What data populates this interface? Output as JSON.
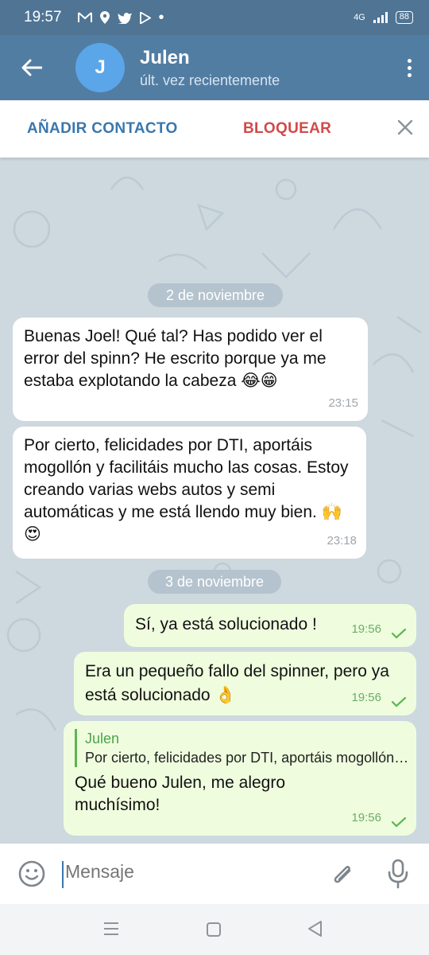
{
  "status_bar": {
    "time": "19:57",
    "network": "4G",
    "battery": "88",
    "notification_icons": [
      "gmail-icon",
      "location-icon",
      "twitter-icon",
      "play-store-icon",
      "dot-icon"
    ]
  },
  "header": {
    "avatar_letter": "J",
    "name": "Julen",
    "status": "últ. vez recientemente",
    "avatar_color": "#5aa6e8",
    "bar_color": "#527da3"
  },
  "action_bar": {
    "add_contact": "AÑADIR CONTACTO",
    "block": "BLOQUEAR"
  },
  "chat": {
    "dates": [
      "2 de noviembre",
      "3 de noviembre"
    ],
    "messages": [
      {
        "direction": "in",
        "text": "Buenas Joel! Qué tal? Has podido ver el error del spinn? He escrito porque ya me estaba explotando la cabeza 😂😁",
        "time": "23:15"
      },
      {
        "direction": "in",
        "text": "Por cierto, felicidades por DTI, aportáis mogollón y facilitáis mucho las cosas. Estoy creando varias webs autos y semi automáticas y me está llendo muy bien. 🙌😍",
        "time": "23:18"
      },
      {
        "direction": "out",
        "text": "Sí, ya está solucionado !",
        "time": "19:56"
      },
      {
        "direction": "out",
        "text": "Era un pequeño fallo del spinner, pero ya está solucionado 👌",
        "time": "19:56"
      },
      {
        "direction": "out",
        "reply_name": "Julen",
        "reply_text": "Por cierto, felicidades por DTI, aportáis mogollón y facilitáis mucho las cosas.",
        "text": "Qué bueno Julen, me alegro muchísimo!",
        "time": "19:56"
      }
    ]
  },
  "input": {
    "placeholder": "Mensaje"
  }
}
